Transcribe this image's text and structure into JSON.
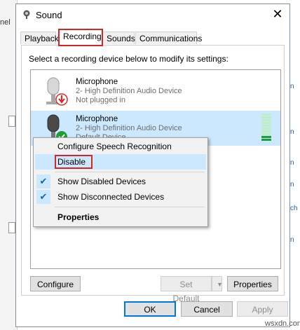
{
  "background": {
    "left_fragment": "nel",
    "right_fragments": [
      "n",
      "n",
      "n",
      "n",
      "ch",
      "n"
    ]
  },
  "window": {
    "title": "Sound",
    "close_glyph": "✕"
  },
  "tabs": [
    {
      "label": "Playback"
    },
    {
      "label": "Recording"
    },
    {
      "label": "Sounds"
    },
    {
      "label": "Communications"
    }
  ],
  "instruction": "Select a recording device below to modify its settings:",
  "devices": [
    {
      "name": "Microphone",
      "line1": "2- High Definition Audio Device",
      "line2": "Not plugged in",
      "status_icon": "unplugged-arrow-icon"
    },
    {
      "name": "Microphone",
      "line1": "2- High Definition Audio Device",
      "line2": "Default Device",
      "status_icon": "default-check-icon"
    }
  ],
  "context_menu": {
    "items": [
      {
        "label": "Configure Speech Recognition"
      },
      {
        "label": "Disable"
      },
      {
        "label": "Show Disabled Devices",
        "checked": true
      },
      {
        "label": "Show Disconnected Devices",
        "checked": true
      },
      {
        "label": "Properties"
      }
    ],
    "check_glyph": "✔"
  },
  "buttons": {
    "configure": "Configure",
    "set_default": "Set Default",
    "set_default_arrow": "▼",
    "properties": "Properties",
    "ok": "OK",
    "cancel": "Cancel",
    "apply": "Apply"
  },
  "level_meter": {
    "level": 0.15
  },
  "colors": {
    "accent": "#0078d7",
    "selection": "#cce8ff",
    "highlight_outline": "#d32626",
    "status_red": "#d62b2b",
    "status_green": "#1c9e3a"
  },
  "watermark": "wsxdn.com"
}
